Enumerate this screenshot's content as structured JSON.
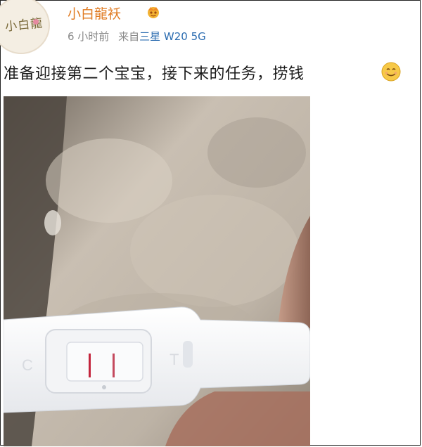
{
  "post": {
    "username": "小白龍袄",
    "time": "6 小时前",
    "source_prefix": "来自",
    "device": "三星 W20 5G",
    "text": "准备迎接第二个宝宝，接下来的任务，捞钱",
    "avatar_text": "小白龍"
  },
  "colors": {
    "username": "#e07b22",
    "device_link": "#2b6cb0",
    "meta": "#8a8a8a"
  },
  "icons": {
    "verified": "crown-badge-icon",
    "emoji": "smile-emoji-icon"
  },
  "photo": {
    "test_letters": [
      "C",
      "T"
    ]
  }
}
